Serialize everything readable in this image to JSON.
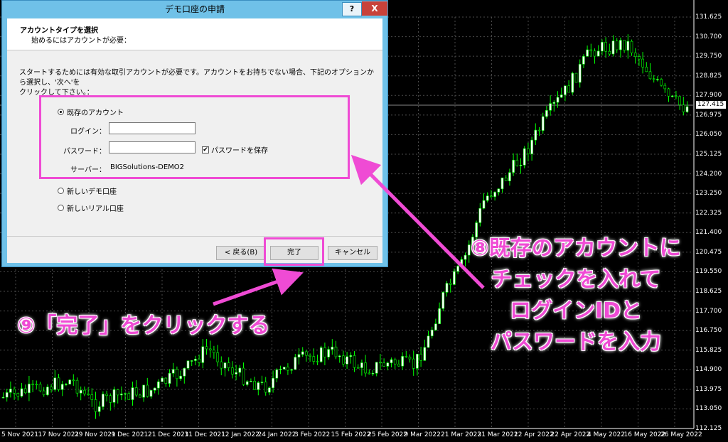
{
  "dialog": {
    "title": "デモ口座の申請",
    "help_label": "?",
    "close_label": "X",
    "header_title": "アカウントタイプを選択",
    "header_subtitle": "始めるにはアカウントが必要：",
    "description_line1": "スタートするためには有効な取引アカウントが必要です。アカウントをお持ちでない場合、下記のオプションから選択し、'次へ'を",
    "description_line2": "クリックして下さい。：",
    "options": {
      "existing": "既存のアカウント",
      "new_demo": "新しいデモ口座",
      "new_real": "新しいリアル口座"
    },
    "selected_option": "existing",
    "login_label": "ログイン：",
    "login_value": "",
    "password_label": "パスワード：",
    "password_value": "",
    "save_password_label": "パスワードを保存",
    "save_password_checked": true,
    "server_label": "サーバー：",
    "server_value": "BIGSolutions-DEMO2",
    "back_button": "< 戻る(B)",
    "finish_button": "完了",
    "cancel_button": "キャンセル"
  },
  "annotations": {
    "step8_line1": "⑧既存のアカウントに",
    "step8_line2": "チェックを入れて",
    "step8_line3": "ログインIDと",
    "step8_line4": "パスワードを入力",
    "step9": "⑨「完了」をクリックする",
    "color": "#ef4bd4"
  },
  "chart": {
    "current_price": "127.415",
    "y_ticks": [
      "131.625",
      "130.700",
      "129.750",
      "128.825",
      "127.900",
      "126.975",
      "126.050",
      "125.125",
      "124.200",
      "123.250",
      "122.325",
      "121.400",
      "120.475",
      "119.550",
      "118.625",
      "117.700",
      "116.750",
      "115.825",
      "114.900",
      "113.975",
      "113.050",
      "112.125"
    ],
    "x_ticks": [
      "5 Nov 2021",
      "17 Nov 2021",
      "29 Nov 2021",
      "9 Dec 2021",
      "21 Dec 2021",
      "31 Dec 2021",
      "12 Jan 2022",
      "24 Jan 2022",
      "3 Feb 2022",
      "15 Feb 2022",
      "25 Feb 2022",
      "9 Mar 2022",
      "21 Mar 2022",
      "31 Mar 2022",
      "12 Apr 2022",
      "22 Apr 2022",
      "4 May 2022",
      "16 May 2022",
      "26 May 2022"
    ],
    "bull_color": "#ffffff",
    "bear_color": "#000000",
    "line_color": "#00ff00",
    "grid_color": "#4a4a4a"
  }
}
